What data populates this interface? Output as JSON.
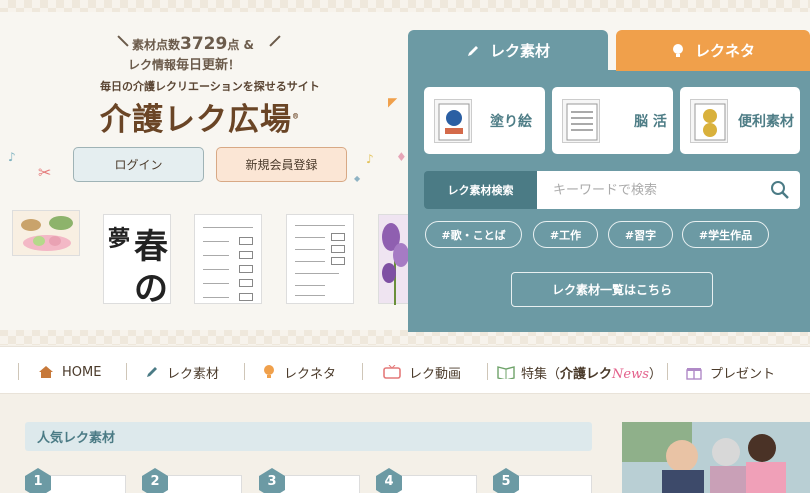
{
  "hero": {
    "tagline_prefix": "素材点数",
    "material_count": "3729",
    "tagline_suffix": "点 &",
    "tagline2_prefix": "レク情報",
    "tagline2_emph": "毎日更新",
    "tagline2_suffix": "！",
    "subtitle": "毎日の介護レクリエーションを探せるサイト",
    "logo": "介護レク広場",
    "logo_mark": "®",
    "login_label": "ログイン",
    "register_label": "新規会員登録",
    "calendar_chars": [
      "夢",
      "春",
      "の"
    ]
  },
  "panel": {
    "tabs": [
      {
        "label": "レク素材",
        "icon": "pencil-icon",
        "active": true
      },
      {
        "label": "レクネタ",
        "icon": "lightbulb-icon",
        "active": false
      }
    ],
    "categories": [
      {
        "label": "塗り絵",
        "icon": "coloring-book-icon"
      },
      {
        "label": "脳 活",
        "icon": "brain-worksheet-icon"
      },
      {
        "label": "便利素材",
        "icon": "coin-material-icon"
      }
    ],
    "search_label": "レク素材検索",
    "search_placeholder": "キーワードで検索",
    "tags": [
      "#歌・ことば",
      "#工作",
      "#習字",
      "#学生作品"
    ],
    "list_button": "レク素材一覧はこちら"
  },
  "nav": {
    "items": [
      {
        "label": "HOME",
        "icon": "home-icon"
      },
      {
        "label": "レク素材",
        "icon": "pencil-icon"
      },
      {
        "label": "レクネタ",
        "icon": "lightbulb-icon"
      },
      {
        "label": "レク動画",
        "icon": "tv-icon"
      },
      {
        "label": "特集（",
        "emph": "介護レク",
        "script": "News",
        "suffix": "）",
        "icon": "book-icon"
      },
      {
        "label": "プレゼント",
        "icon": "gift-icon"
      }
    ]
  },
  "popular": {
    "heading": "人気レク素材",
    "ranks": [
      "1",
      "2",
      "3",
      "4",
      "5"
    ]
  },
  "colors": {
    "teal": "#6c9aa4",
    "orange": "#f0a04b",
    "brown": "#6a4526"
  }
}
